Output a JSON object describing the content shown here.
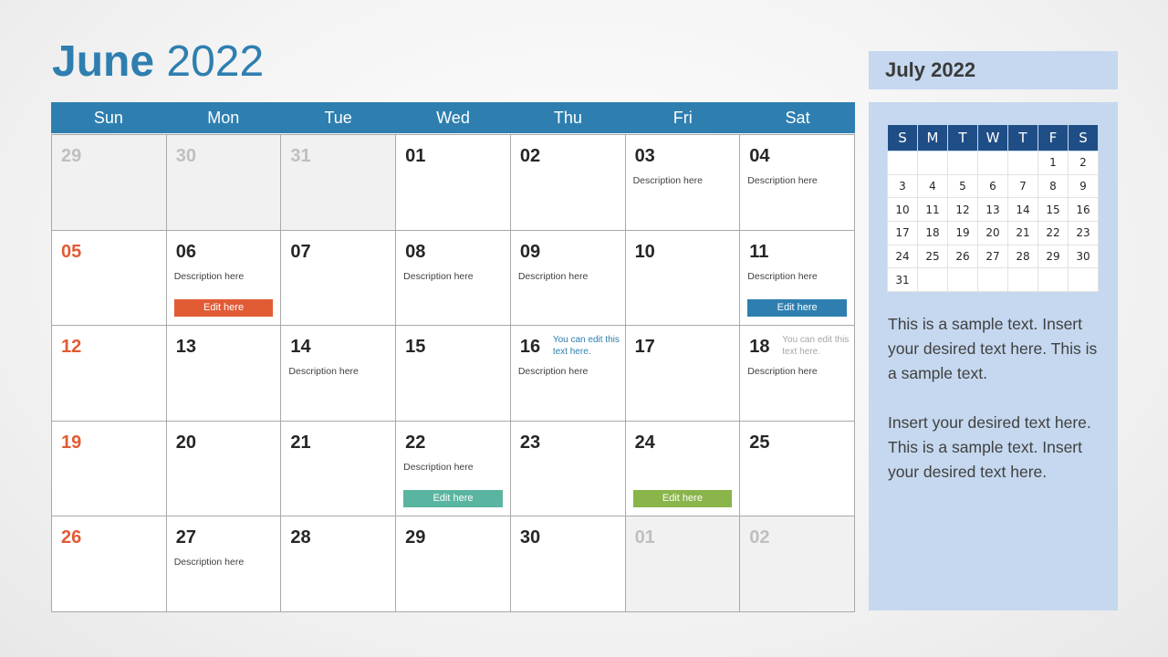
{
  "title": {
    "month": "June",
    "year": "2022"
  },
  "colors": {
    "accent": "#2e7fb0",
    "sunday": "#e15b35",
    "edit_orange": "#e15b35",
    "edit_blue": "#2e7fb0",
    "edit_teal": "#5ab5a0",
    "edit_green": "#8ab54a",
    "side_panel": "#c5d8ef",
    "mini_header": "#1f4e87"
  },
  "weekdays": [
    "Sun",
    "Mon",
    "Tue",
    "Wed",
    "Thu",
    "Fri",
    "Sat"
  ],
  "weeks": [
    [
      {
        "day": "29",
        "other": true
      },
      {
        "day": "30",
        "other": true
      },
      {
        "day": "31",
        "other": true
      },
      {
        "day": "01"
      },
      {
        "day": "02"
      },
      {
        "day": "03",
        "desc": "Description here"
      },
      {
        "day": "04",
        "desc": "Description here"
      }
    ],
    [
      {
        "day": "05",
        "sunday": true
      },
      {
        "day": "06",
        "desc": "Description here",
        "edit": "Edit here",
        "edit_color": "#e15b35"
      },
      {
        "day": "07"
      },
      {
        "day": "08",
        "desc": "Description here"
      },
      {
        "day": "09",
        "desc": "Description here"
      },
      {
        "day": "10"
      },
      {
        "day": "11",
        "desc": "Description here",
        "edit": "Edit here",
        "edit_color": "#2e7fb0"
      }
    ],
    [
      {
        "day": "12",
        "sunday": true
      },
      {
        "day": "13"
      },
      {
        "day": "14",
        "desc": "Description here"
      },
      {
        "day": "15"
      },
      {
        "day": "16",
        "desc": "Description here",
        "note": "You can edit this text here.",
        "note_style": "blue"
      },
      {
        "day": "17"
      },
      {
        "day": "18",
        "desc": "Description here",
        "note": "You can edit this text here.",
        "note_style": "grey"
      }
    ],
    [
      {
        "day": "19",
        "sunday": true
      },
      {
        "day": "20"
      },
      {
        "day": "21"
      },
      {
        "day": "22",
        "desc": "Description here",
        "edit": "Edit here",
        "edit_color": "#5ab5a0"
      },
      {
        "day": "23"
      },
      {
        "day": "24",
        "edit": "Edit here",
        "edit_color": "#8ab54a"
      },
      {
        "day": "25"
      }
    ],
    [
      {
        "day": "26",
        "sunday": true
      },
      {
        "day": "27",
        "desc": "Description here"
      },
      {
        "day": "28"
      },
      {
        "day": "29"
      },
      {
        "day": "30"
      },
      {
        "day": "01",
        "other": true
      },
      {
        "day": "02",
        "other": true
      }
    ]
  ],
  "side": {
    "title": "July 2022",
    "mini_weekdays": [
      "S",
      "M",
      "T",
      "W",
      "T",
      "F",
      "S"
    ],
    "mini_weeks": [
      [
        "",
        "",
        "",
        "",
        "",
        "1",
        "2"
      ],
      [
        "3",
        "4",
        "5",
        "6",
        "7",
        "8",
        "9"
      ],
      [
        "10",
        "11",
        "12",
        "13",
        "14",
        "15",
        "16"
      ],
      [
        "17",
        "18",
        "19",
        "20",
        "21",
        "22",
        "23"
      ],
      [
        "24",
        "25",
        "26",
        "27",
        "28",
        "29",
        "30"
      ],
      [
        "31",
        "",
        "",
        "",
        "",
        "",
        ""
      ]
    ],
    "paragraphs": [
      "This is a sample text. Insert your desired text here. This is a sample text.",
      "Insert your desired text here. This is a sample text. Insert your desired text here."
    ]
  }
}
